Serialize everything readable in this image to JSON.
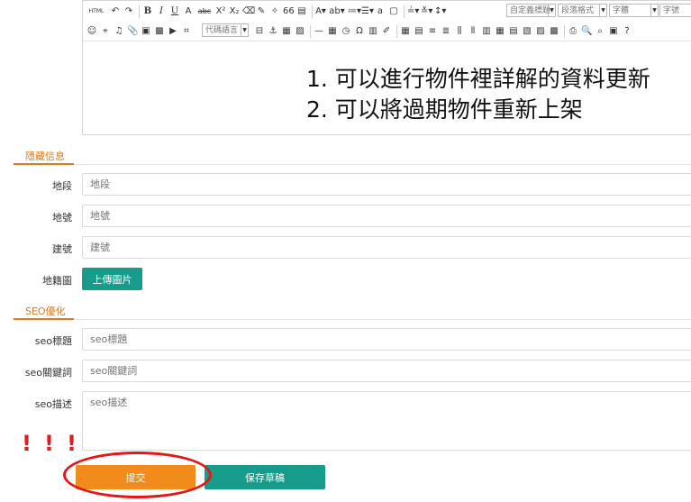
{
  "editor": {
    "toolbar_row1": [
      {
        "name": "html-source-icon",
        "glyph": "HTML"
      },
      {
        "name": "undo-icon",
        "glyph": "↶"
      },
      {
        "name": "redo-icon",
        "glyph": "↷"
      },
      {
        "name": "bold-icon",
        "glyph": "B"
      },
      {
        "name": "italic-icon",
        "glyph": "I"
      },
      {
        "name": "underline-icon",
        "glyph": "U"
      },
      {
        "name": "font-border-icon",
        "glyph": "A"
      },
      {
        "name": "strikethrough-icon",
        "glyph": "abc"
      },
      {
        "name": "superscript-icon",
        "glyph": "X²"
      },
      {
        "name": "subscript-icon",
        "glyph": "X₂"
      },
      {
        "name": "eraser-icon",
        "glyph": "⌫"
      },
      {
        "name": "format-brush-icon",
        "glyph": "✎"
      },
      {
        "name": "auto-format-icon",
        "glyph": "✧"
      },
      {
        "name": "blockquote-icon",
        "glyph": "66"
      },
      {
        "name": "paste-plain-icon",
        "glyph": "▤"
      },
      {
        "name": "font-color-icon",
        "glyph": "A▾"
      },
      {
        "name": "highlight-icon",
        "glyph": "ab▾"
      },
      {
        "name": "ordered-list-icon",
        "glyph": "≔▾"
      },
      {
        "name": "unordered-list-icon",
        "glyph": "☰▾"
      },
      {
        "name": "select-all-icon",
        "glyph": "a"
      },
      {
        "name": "clear-doc-icon",
        "glyph": "▢"
      },
      {
        "name": "row-spacing-top-icon",
        "glyph": "≟▾"
      },
      {
        "name": "row-spacing-bottom-icon",
        "glyph": "≚▾"
      },
      {
        "name": "line-height-icon",
        "glyph": "↕▾"
      }
    ],
    "selects": {
      "custom_title": "自定義標題",
      "paragraph_format": "段落格式",
      "font_family": "字體",
      "font_size": "字號"
    },
    "toolbar_row2": [
      {
        "name": "emotion-icon",
        "glyph": "☺"
      },
      {
        "name": "map-icon",
        "glyph": "⌖"
      },
      {
        "name": "music-icon",
        "glyph": "♫"
      },
      {
        "name": "attachment-icon",
        "glyph": "📎"
      },
      {
        "name": "image-icon",
        "glyph": "▣"
      },
      {
        "name": "multi-image-icon",
        "glyph": "▩"
      },
      {
        "name": "video-icon",
        "glyph": "▶"
      },
      {
        "name": "insert-code-icon",
        "glyph": "⌗"
      }
    ],
    "code_lang_placeholder": "代碼語言",
    "toolbar_row2b": [
      {
        "name": "page-break-icon",
        "glyph": "⊟"
      },
      {
        "name": "anchor-icon",
        "glyph": "⚓"
      },
      {
        "name": "template-icon",
        "glyph": "▦"
      },
      {
        "name": "background-icon",
        "glyph": "▨"
      },
      {
        "name": "horizontal-rule-icon",
        "glyph": "—"
      },
      {
        "name": "date-icon",
        "glyph": "▦"
      },
      {
        "name": "time-icon",
        "glyph": "◷"
      },
      {
        "name": "special-char-icon",
        "glyph": "Ω"
      },
      {
        "name": "wordimage-icon",
        "glyph": "▥"
      },
      {
        "name": "scrawl-icon",
        "glyph": "✐"
      },
      {
        "name": "insert-table-icon",
        "glyph": "▦"
      },
      {
        "name": "delete-table-icon",
        "glyph": "▤"
      },
      {
        "name": "insert-row-icon",
        "glyph": "≡"
      },
      {
        "name": "delete-row-icon",
        "glyph": "≣"
      },
      {
        "name": "insert-col-icon",
        "glyph": "⫼"
      },
      {
        "name": "delete-col-icon",
        "glyph": "⫴"
      },
      {
        "name": "merge-cells-icon",
        "glyph": "▥"
      },
      {
        "name": "merge-right-icon",
        "glyph": "▦"
      },
      {
        "name": "merge-down-icon",
        "glyph": "▤"
      },
      {
        "name": "split-cells-icon",
        "glyph": "▧"
      },
      {
        "name": "split-rows-icon",
        "glyph": "▨"
      },
      {
        "name": "split-cols-icon",
        "glyph": "▩"
      },
      {
        "name": "print-icon",
        "glyph": "⎙"
      },
      {
        "name": "preview-icon",
        "glyph": "🔍"
      },
      {
        "name": "search-replace-icon",
        "glyph": "⌕"
      },
      {
        "name": "drafts-icon",
        "glyph": "▣"
      },
      {
        "name": "help-icon",
        "glyph": "?"
      }
    ],
    "content_lines": [
      "1. 可以進行物件裡詳解的資料更新",
      "2. 可以將過期物件重新上架"
    ]
  },
  "hidden_section": {
    "title": "隱藏信息",
    "land_section": {
      "label": "地段",
      "placeholder": "地段"
    },
    "land_number": {
      "label": "地號",
      "placeholder": "地號"
    },
    "building_number": {
      "label": "建號",
      "placeholder": "建號"
    },
    "cadastral_map": {
      "label": "地籍圖",
      "button": "上傳圖片"
    }
  },
  "seo_section": {
    "title": "SEO優化",
    "seo_title": {
      "label": "seo標題",
      "placeholder": "seo標題"
    },
    "seo_keywords": {
      "label": "seo關鍵詞",
      "placeholder": "seo關鍵詞"
    },
    "seo_description": {
      "label": "seo描述",
      "placeholder": "seo描述"
    }
  },
  "annotation": {
    "marks": "! ! !",
    "color": "#e21b1b"
  },
  "actions": {
    "submit": "提交",
    "save_draft": "保存草稿"
  },
  "colors": {
    "accent_orange": "#f18b1c",
    "accent_teal": "#179b8b",
    "section_title": "#e07a1a"
  }
}
